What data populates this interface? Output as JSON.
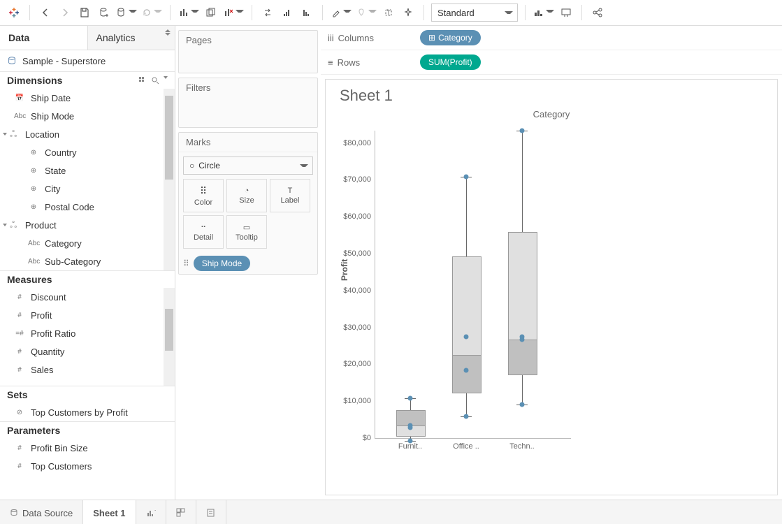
{
  "toolbar": {
    "fit_mode": "Standard"
  },
  "data_pane": {
    "tabs": {
      "data": "Data",
      "analytics": "Analytics"
    },
    "datasource": "Sample - Superstore",
    "dimensions_label": "Dimensions",
    "dimensions": {
      "ship_date": "Ship Date",
      "ship_mode": "Ship Mode",
      "location": "Location",
      "country": "Country",
      "state": "State",
      "city": "City",
      "postal_code": "Postal Code",
      "product": "Product",
      "category": "Category",
      "sub_category": "Sub-Category"
    },
    "measures_label": "Measures",
    "measures": {
      "discount": "Discount",
      "profit": "Profit",
      "profit_ratio": "Profit Ratio",
      "quantity": "Quantity",
      "sales": "Sales"
    },
    "sets_label": "Sets",
    "sets": {
      "top_cust_profit": "Top Customers by Profit"
    },
    "parameters_label": "Parameters",
    "parameters": {
      "profit_bin": "Profit Bin Size",
      "top_customers": "Top Customers"
    }
  },
  "shelves": {
    "pages": "Pages",
    "filters": "Filters",
    "marks": "Marks",
    "mark_type": "Circle",
    "cells": {
      "color": "Color",
      "size": "Size",
      "label": "Label",
      "detail": "Detail",
      "tooltip": "Tooltip"
    },
    "mark_pill": "Ship Mode"
  },
  "columns_row": {
    "label": "Columns",
    "pill": "Category"
  },
  "rows_row": {
    "label": "Rows",
    "pill": "SUM(Profit)"
  },
  "viz": {
    "sheet_title": "Sheet 1",
    "header": "Category",
    "y_axis_label": "Profit",
    "y_ticks": [
      "$0",
      "$10,000",
      "$20,000",
      "$30,000",
      "$40,000",
      "$50,000",
      "$60,000",
      "$70,000",
      "$80,000"
    ],
    "x_labels": [
      "Furnit..",
      "Office ..",
      "Techn.."
    ]
  },
  "bottom": {
    "data_source": "Data Source",
    "sheet": "Sheet 1"
  },
  "chart_data": {
    "type": "boxplot",
    "ylabel": "Profit",
    "ylim": [
      -2000,
      85000
    ],
    "categories": [
      "Furniture",
      "Office Supplies",
      "Technology"
    ],
    "series": [
      {
        "name": "Furniture",
        "box": {
          "min": -1000,
          "q1": 500,
          "median": 3000,
          "q3": 7500,
          "max": 10500
        },
        "points": [
          -1000,
          2500,
          3000,
          10500
        ]
      },
      {
        "name": "Office Supplies",
        "box": {
          "min": 6000,
          "q1": 12500,
          "median": 22500,
          "q3": 49000,
          "max": 70500
        },
        "points": [
          6000,
          18500,
          27000,
          70500
        ]
      },
      {
        "name": "Technology",
        "box": {
          "min": 9000,
          "q1": 17500,
          "median": 27000,
          "q3": 55500,
          "max": 83000
        },
        "points": [
          9000,
          26500,
          27500,
          83000
        ]
      }
    ]
  }
}
